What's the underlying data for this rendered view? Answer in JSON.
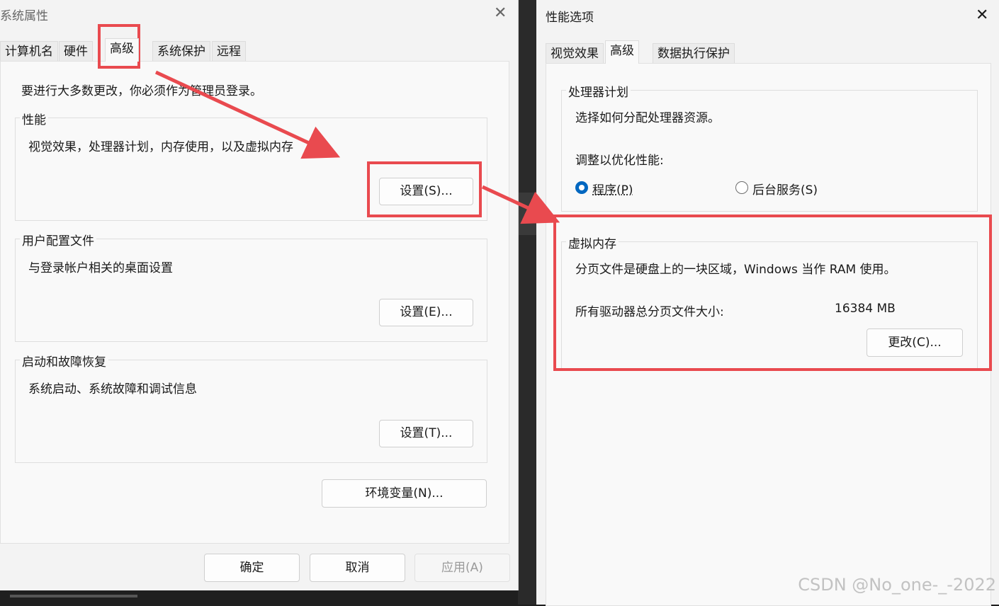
{
  "left_window": {
    "title": "系统属性",
    "tabs": [
      "计算机名",
      "硬件",
      "高级",
      "系统保护",
      "远程"
    ],
    "active_tab": "高级",
    "admin_note": "要进行大多数更改，你必须作为管理员登录。",
    "performance": {
      "label": "性能",
      "description": "视觉效果，处理器计划，内存使用，以及虚拟内存",
      "button": "设置(S)..."
    },
    "user_profiles": {
      "label": "用户配置文件",
      "description": "与登录帐户相关的桌面设置",
      "button": "设置(E)..."
    },
    "startup_recovery": {
      "label": "启动和故障恢复",
      "description": "系统启动、系统故障和调试信息",
      "button": "设置(T)..."
    },
    "env_button": "环境变量(N)...",
    "ok": "确定",
    "cancel": "取消",
    "apply": "应用(A)"
  },
  "right_window": {
    "title": "性能选项",
    "tabs": [
      "视觉效果",
      "高级",
      "数据执行保护"
    ],
    "active_tab": "高级",
    "processor": {
      "label": "处理器计划",
      "description": "选择如何分配处理器资源。",
      "adjust_label": "调整以优化性能:",
      "option_programs": "程序(P)",
      "option_services": "后台服务(S)",
      "selected": "程序(P)"
    },
    "virtual_memory": {
      "label": "虚拟内存",
      "description": "分页文件是硬盘上的一块区域，Windows 当作 RAM 使用。",
      "total_label": "所有驱动器总分页文件大小:",
      "total_value": "16384 MB",
      "change_button": "更改(C)..."
    }
  },
  "watermark": "CSDN @No_one-_-2022",
  "colors": {
    "highlight": "#e94a4f",
    "radio_selected": "#0067c0",
    "window_bg": "#f3f3f3"
  }
}
